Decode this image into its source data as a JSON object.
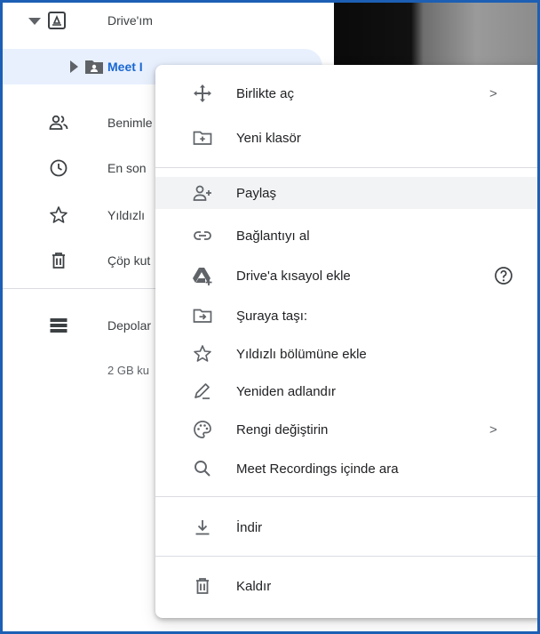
{
  "sidebar": {
    "my_drive": "Drive'ım",
    "meet_folder": "Meet I",
    "shared": "Benimle",
    "recent": "En son",
    "starred": "Yıldızlı",
    "trash": "Çöp kut",
    "storage": "Depolar",
    "storage_used": "2 GB ku"
  },
  "menu": {
    "open_with": "Birlikte aç",
    "new_folder": "Yeni klasör",
    "share": "Paylaş",
    "get_link": "Bağlantıyı al",
    "add_shortcut": "Drive'a kısayol ekle",
    "move_to": "Şuraya taşı:",
    "add_starred": "Yıldızlı bölümüne ekle",
    "rename": "Yeniden adlandır",
    "change_color": "Rengi değiştirin",
    "search_in": "Meet Recordings içinde ara",
    "download": "İndir",
    "remove": "Kaldır",
    "submenu_arrow": ">"
  },
  "colors": {
    "accent": "#1967d2",
    "frame": "#1c5fb4",
    "highlight": "#f1f3f4",
    "selected_row": "#e8f0fe"
  }
}
